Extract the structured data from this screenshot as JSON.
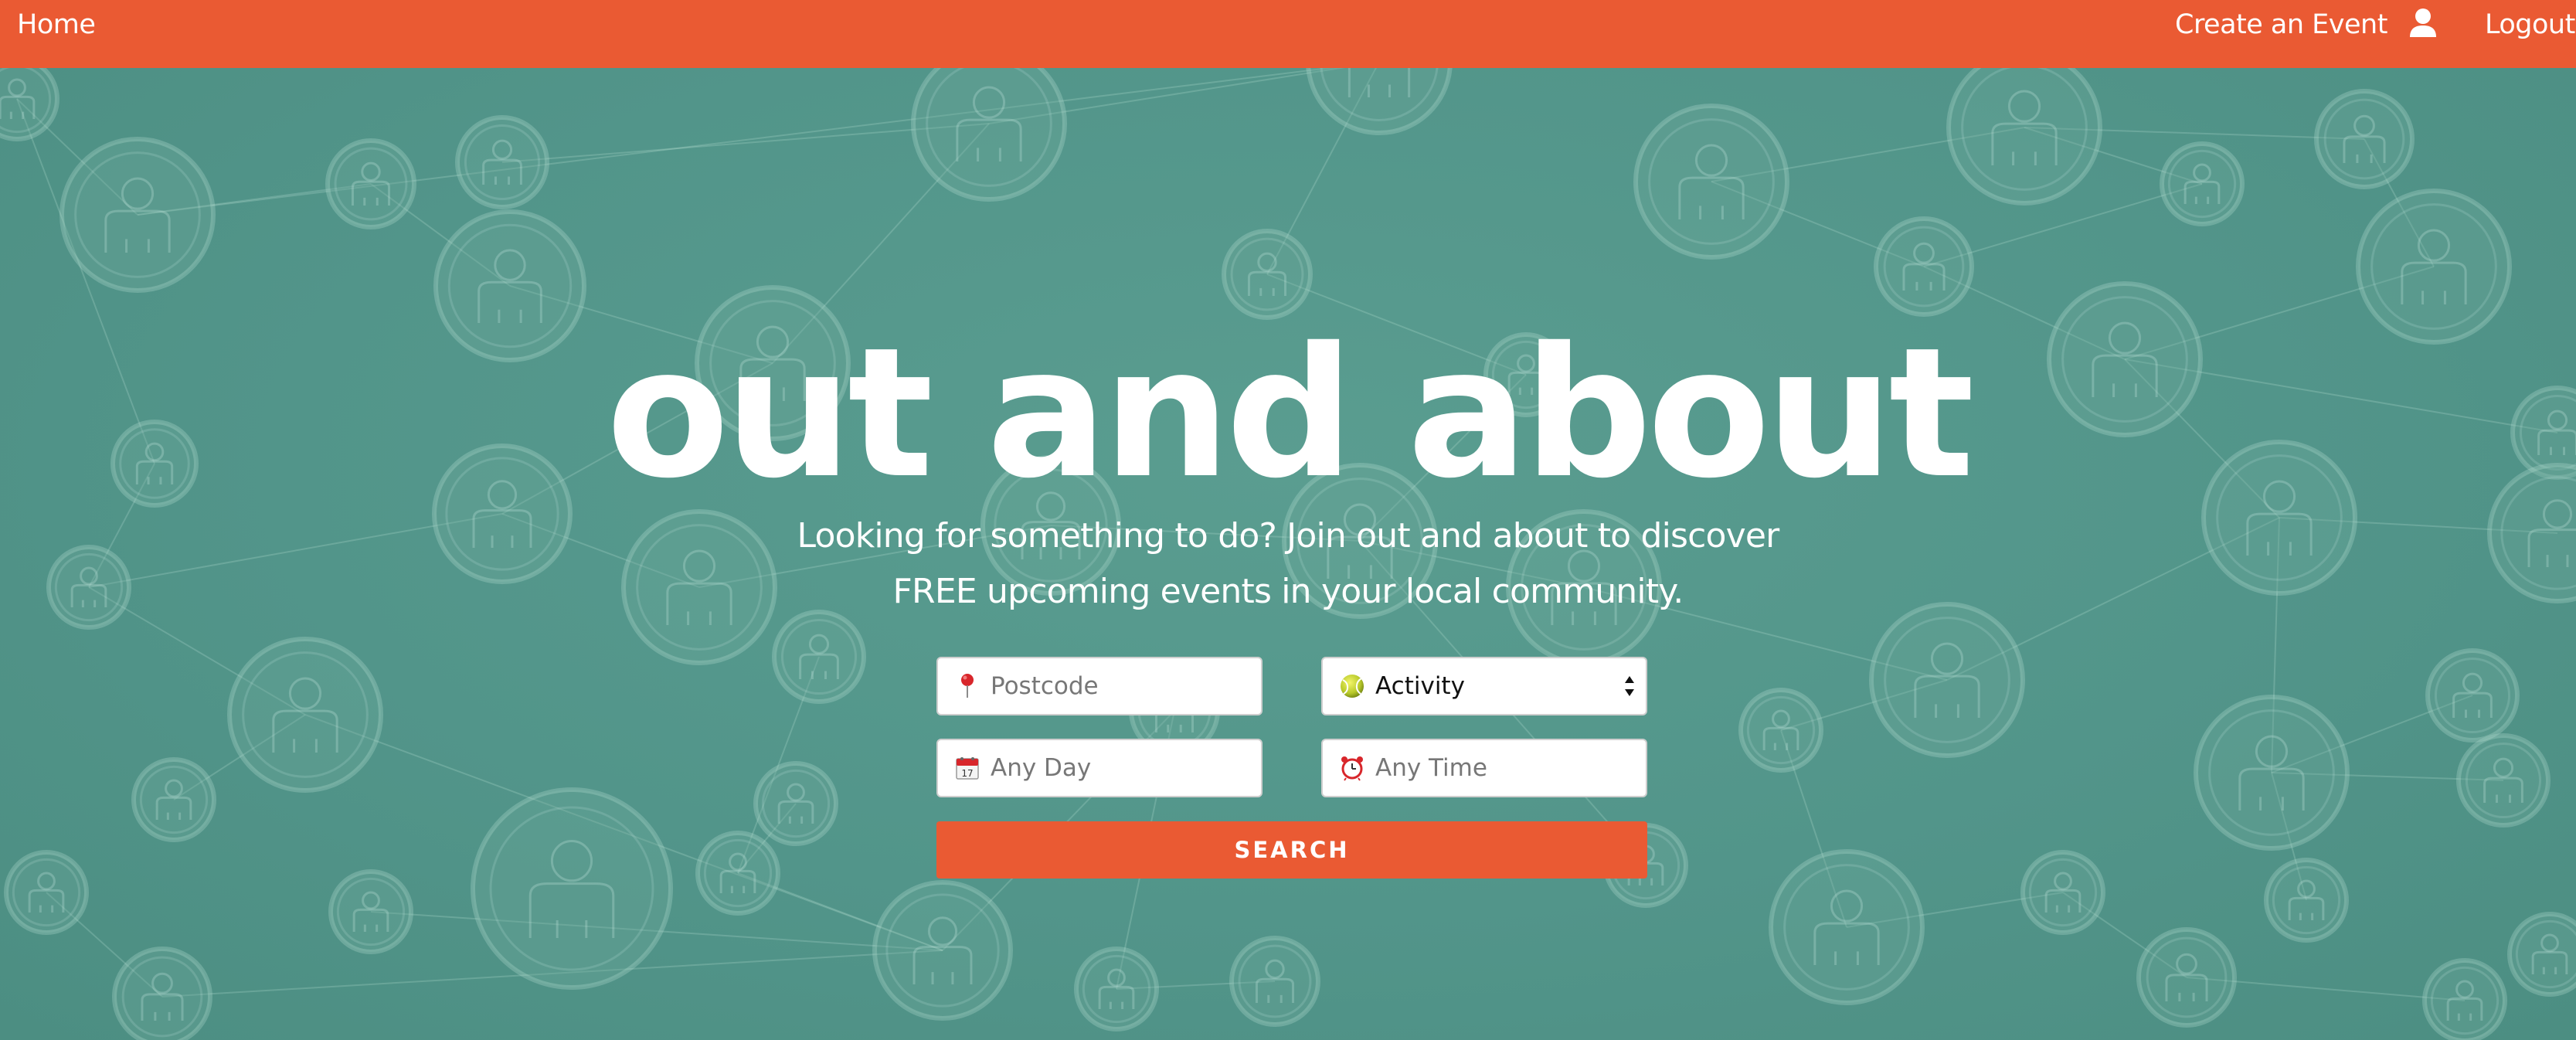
{
  "nav": {
    "home": "Home",
    "create_event": "Create an Event",
    "user_icon": "user-icon",
    "logout": "Logout"
  },
  "hero": {
    "title": "out and about",
    "subtitle_line1": "Looking for something to do? Join out and about to discover",
    "subtitle_line2": "FREE upcoming events in your local community."
  },
  "search": {
    "postcode": {
      "placeholder": "Postcode",
      "icon": "map-pin-icon",
      "value": ""
    },
    "activity": {
      "selected": "Activity",
      "icon": "tennis-ball-icon"
    },
    "day": {
      "placeholder": "Any Day",
      "icon": "calendar-icon",
      "value": ""
    },
    "time": {
      "placeholder": "Any Time",
      "icon": "alarm-clock-icon",
      "value": ""
    },
    "button_label": "SEARCH"
  },
  "colors": {
    "brand_orange": "#ea5a33",
    "background_teal": "#55978a",
    "text_white": "#ffffff"
  }
}
